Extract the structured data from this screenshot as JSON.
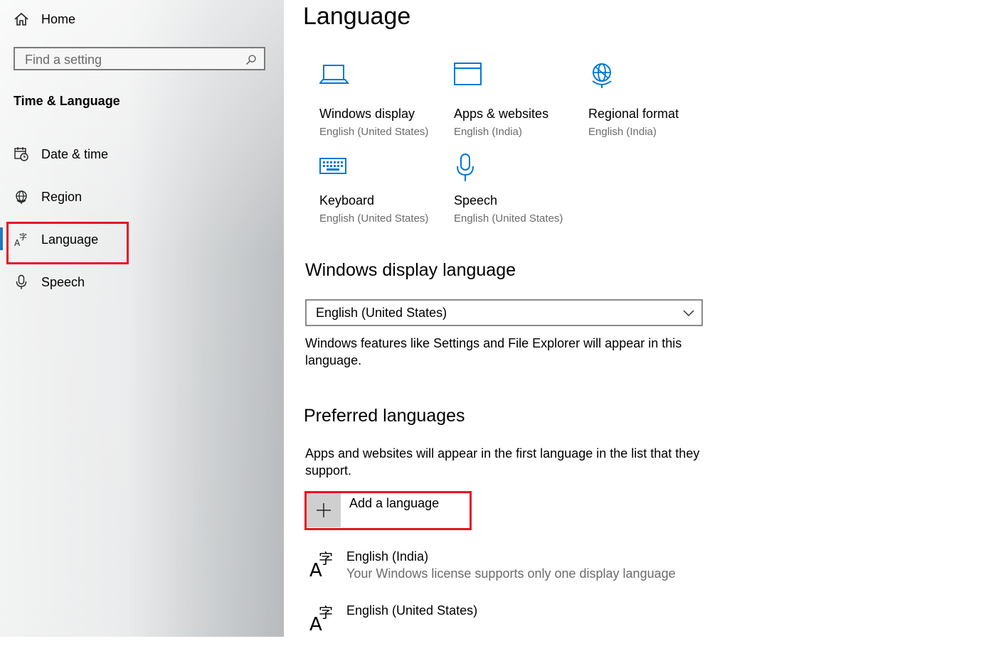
{
  "sidebar": {
    "home_label": "Home",
    "search_placeholder": "Find a setting",
    "section_title": "Time & Language",
    "items": [
      {
        "label": "Date & time",
        "icon": "calendar-clock-icon"
      },
      {
        "label": "Region",
        "icon": "globe-icon"
      },
      {
        "label": "Language",
        "icon": "language-icon",
        "selected": true
      },
      {
        "label": "Speech",
        "icon": "microphone-icon"
      }
    ]
  },
  "main": {
    "title": "Language",
    "tiles": [
      {
        "name": "Windows display",
        "sub": "English (United States)",
        "icon": "laptop-icon"
      },
      {
        "name": "Apps & websites",
        "sub": "English (India)",
        "icon": "window-icon"
      },
      {
        "name": "Regional format",
        "sub": "English (India)",
        "icon": "globe-icon"
      },
      {
        "name": "Keyboard",
        "sub": "English (United States)",
        "icon": "keyboard-icon"
      },
      {
        "name": "Speech",
        "sub": "English (United States)",
        "icon": "microphone-icon"
      }
    ],
    "display_language": {
      "heading": "Windows display language",
      "selected": "English (United States)",
      "description": "Windows features like Settings and File Explorer will appear in this language."
    },
    "preferred": {
      "heading": "Preferred languages",
      "description": "Apps and websites will appear in the first language in the list that they support.",
      "add_label": "Add a language",
      "languages": [
        {
          "name": "English (India)",
          "note": "Your Windows license supports only one display language"
        },
        {
          "name": "English (United States)",
          "note": ""
        }
      ]
    }
  },
  "colors": {
    "accent": "#0078d7",
    "highlight_box": "#e81123",
    "secondary_text": "#6b6b6b"
  }
}
